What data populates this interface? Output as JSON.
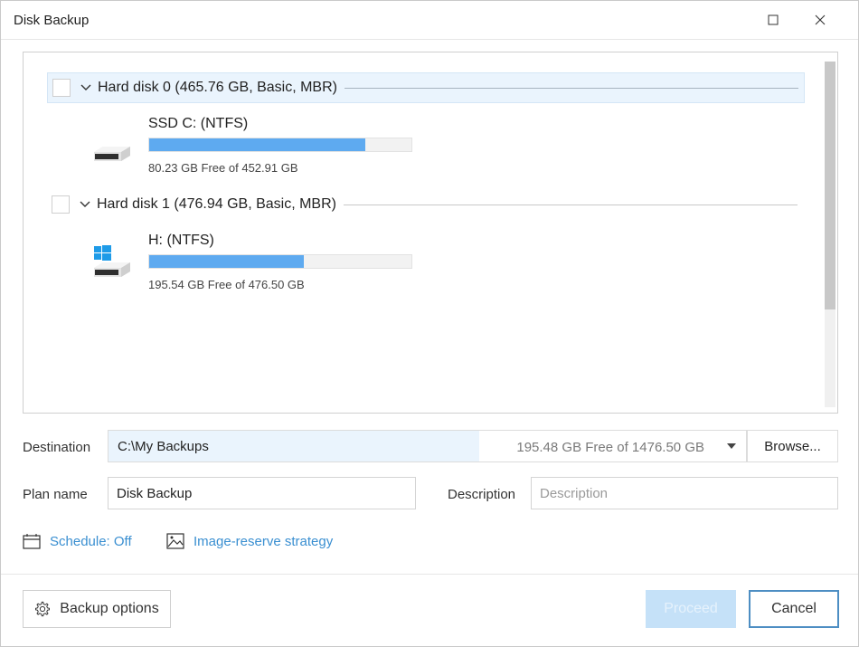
{
  "window": {
    "title": "Disk Backup",
    "maximize_icon": "maximize-icon",
    "close_icon": "close-icon"
  },
  "disks": [
    {
      "label": "Hard disk 0 (465.76 GB, Basic, MBR)",
      "checked": false,
      "expanded": true,
      "selected": true,
      "partitions": [
        {
          "name": "SSD C: (NTFS)",
          "icon": "drive-icon",
          "free_text": "80.23 GB Free of 452.91 GB",
          "used_fraction": 0.823
        }
      ]
    },
    {
      "label": "Hard disk 1 (476.94 GB, Basic, MBR)",
      "checked": false,
      "expanded": true,
      "selected": false,
      "partitions": [
        {
          "name": "H: (NTFS)",
          "icon": "windows-drive-icon",
          "free_text": "195.54 GB Free of 476.50 GB",
          "used_fraction": 0.59
        }
      ]
    }
  ],
  "destination": {
    "label": "Destination",
    "path": "C:\\My Backups",
    "free_text": "195.48 GB Free of 1476.50 GB",
    "browse_label": "Browse..."
  },
  "plan": {
    "label": "Plan name",
    "value": "Disk Backup"
  },
  "description": {
    "label": "Description",
    "value": "",
    "placeholder": "Description"
  },
  "links": {
    "schedule": "Schedule: Off",
    "image_reserve": "Image-reserve strategy"
  },
  "footer": {
    "backup_options": "Backup options",
    "proceed": "Proceed",
    "cancel": "Cancel"
  },
  "colors": {
    "accent": "#3a8fd1",
    "bar_fill": "#5eaaf0",
    "selected_row": "#eaf4fd",
    "proceed_disabled": "#c5e1f8"
  }
}
